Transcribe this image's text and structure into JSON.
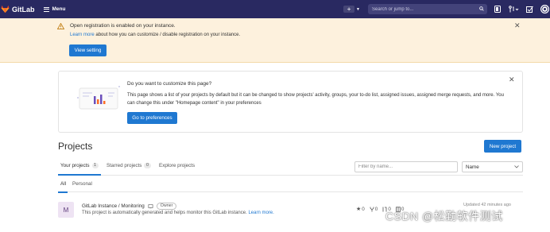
{
  "navbar": {
    "brand": "GitLab",
    "menu_label": "Menu",
    "search_placeholder": "Search or jump to..."
  },
  "banner": {
    "title": "Open registration is enabled on your instance.",
    "link_text": "Learn more",
    "body_rest": " about how you can customize / disable registration on your instance.",
    "button": "View setting"
  },
  "customize": {
    "title": "Do you want to customize this page?",
    "text": "This page shows a list of your projects by default but it can be changed to show projects' activity, groups, your to-do list, assigned issues, assigned merge requests, and more. You can change this under \"Homepage content\" in your preferences",
    "button": "Go to preferences"
  },
  "projects": {
    "title": "Projects",
    "new_button": "New project",
    "tabs": [
      {
        "label": "Your projects",
        "count": "1"
      },
      {
        "label": "Starred projects",
        "count": "0"
      },
      {
        "label": "Explore projects"
      }
    ],
    "filter_placeholder": "Filter by name...",
    "sort_value": "Name",
    "subtabs": [
      "All",
      "Personal"
    ],
    "items": [
      {
        "avatar": "M",
        "name": "GitLab Instance / Monitoring",
        "role": "Owner",
        "description": "This project is automatically generated and helps monitor this GitLab instance. ",
        "desc_link": "Learn more.",
        "stars": "0",
        "forks": "0",
        "merge_requests": "0",
        "issues": "0",
        "updated": "Updated 42 minutes ago"
      }
    ]
  },
  "watermark": "CSDN @松勤软件测试",
  "colors": {
    "navbar": "#292961",
    "primary": "#1f78d1",
    "warning_bg": "#fdf1dd"
  }
}
